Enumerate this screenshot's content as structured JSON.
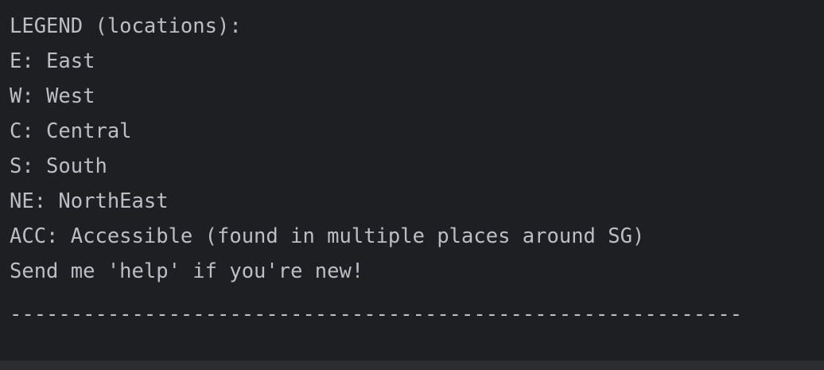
{
  "console": {
    "lines": [
      "LEGEND (locations):",
      "E: East",
      "W: West",
      "C: Central",
      "S: South",
      "NE: NorthEast",
      "ACC: Accessible (found in multiple places around SG)",
      "Send me 'help' if you're new!"
    ],
    "separator": "------------------------------------------------------------"
  },
  "colors": {
    "background": "#1e1f22",
    "text": "#bcbec4",
    "bottom_strip": "#2b2d30"
  }
}
